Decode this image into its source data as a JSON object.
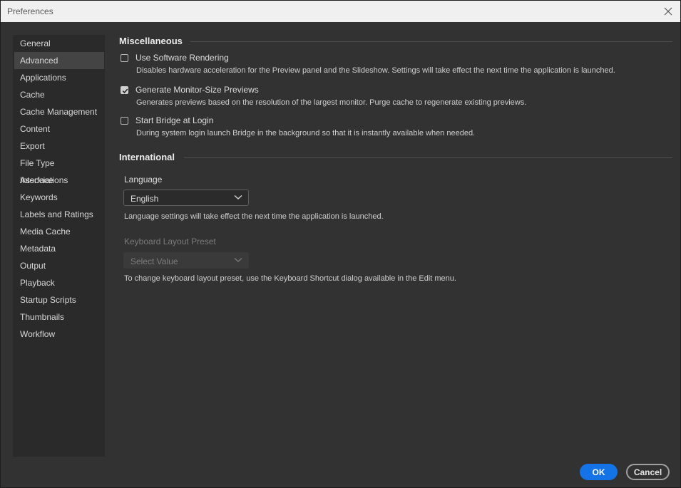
{
  "window": {
    "title": "Preferences"
  },
  "sidebar": {
    "items": [
      {
        "label": "General",
        "active": false
      },
      {
        "label": "Advanced",
        "active": true
      },
      {
        "label": "Applications",
        "active": false
      },
      {
        "label": "Cache",
        "active": false
      },
      {
        "label": "Cache Management",
        "active": false
      },
      {
        "label": "Content",
        "active": false
      },
      {
        "label": "Export",
        "active": false
      },
      {
        "label": "File Type Associations",
        "active": false
      },
      {
        "label": "Interface",
        "active": false
      },
      {
        "label": "Keywords",
        "active": false
      },
      {
        "label": "Labels and Ratings",
        "active": false
      },
      {
        "label": "Media Cache",
        "active": false
      },
      {
        "label": "Metadata",
        "active": false
      },
      {
        "label": "Output",
        "active": false
      },
      {
        "label": "Playback",
        "active": false
      },
      {
        "label": "Startup Scripts",
        "active": false
      },
      {
        "label": "Thumbnails",
        "active": false
      },
      {
        "label": "Workflow",
        "active": false
      }
    ]
  },
  "misc": {
    "title": "Miscellaneous",
    "options": [
      {
        "label": "Use Software Rendering",
        "checked": false,
        "description": "Disables hardware acceleration for the Preview panel and the Slideshow. Settings will take effect the next time the application is launched."
      },
      {
        "label": "Generate Monitor-Size Previews",
        "checked": true,
        "description": "Generates previews based on the resolution of the largest monitor.  Purge cache to regenerate existing previews."
      },
      {
        "label": "Start Bridge at Login",
        "checked": false,
        "description": "During system login launch Bridge in the background so that it is instantly available when needed."
      }
    ]
  },
  "international": {
    "title": "International",
    "language_label": "Language",
    "language_value": "English",
    "language_note": "Language settings will take effect the next time the application is launched.",
    "keyboard_label": "Keyboard Layout Preset",
    "keyboard_value": "Select Value",
    "keyboard_note": "To change keyboard layout preset, use the Keyboard Shortcut dialog available in the Edit menu."
  },
  "footer": {
    "ok_label": "OK",
    "cancel_label": "Cancel"
  },
  "colors": {
    "accent": "#1473e6",
    "background": "#323232",
    "sidebar": "#2a2a2a"
  }
}
